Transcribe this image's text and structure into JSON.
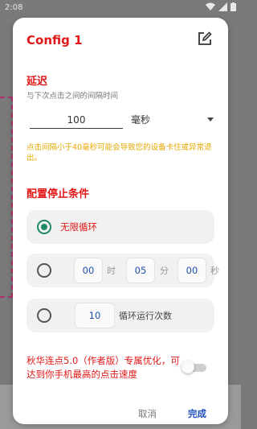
{
  "status_bar": {
    "time": "2:08"
  },
  "dialog": {
    "title": "Config 1",
    "delay": {
      "title": "延迟",
      "subtitle": "与下次点击之间的间隔时间",
      "value": "100",
      "unit": "毫秒",
      "warning": "点击间隔小于40毫秒可能会导致您的设备卡住或异常退出。"
    },
    "stop": {
      "title": "配置停止条件",
      "infinite_label": "无限循环",
      "timer": {
        "hours": "00",
        "hours_unit": "时",
        "minutes": "05",
        "minutes_unit": "分",
        "seconds": "00",
        "seconds_unit": "秒"
      },
      "loop": {
        "count": "10",
        "label": "循环运行次数"
      }
    },
    "promo": "秋华连点5.0（作者版）专属优化，可达到你手机最高的点击速度",
    "cancel_label": "取消",
    "done_label": "完成"
  },
  "colors": {
    "accent_red": "#e01818",
    "radio_green": "#1f8a62",
    "warning_yellow": "#e6a800",
    "button_blue": "#1f4fbf"
  }
}
